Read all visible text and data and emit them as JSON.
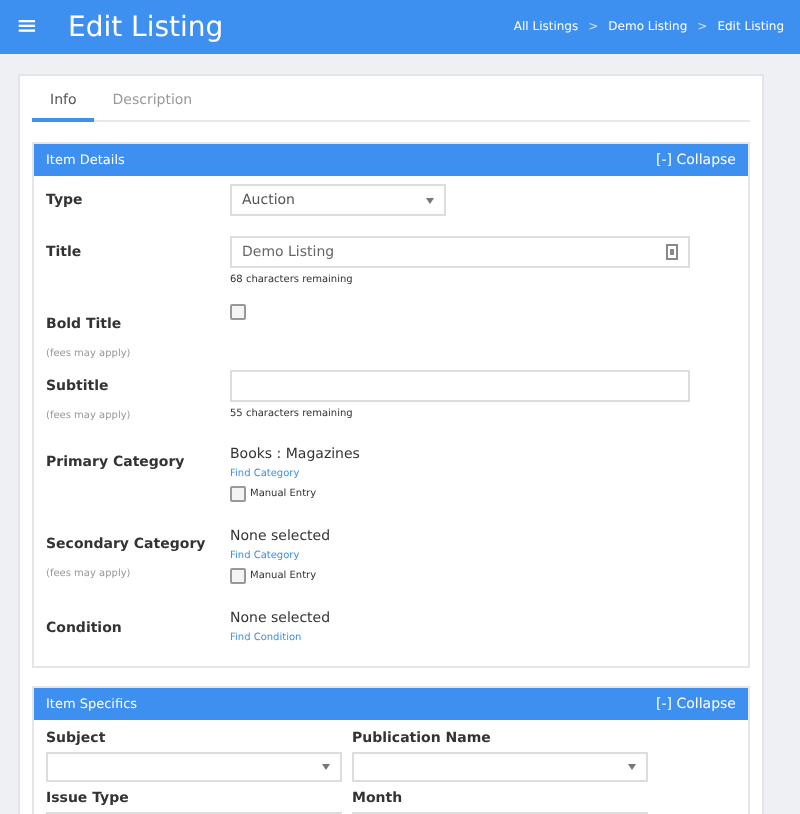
{
  "header": {
    "menu_icon": "≡",
    "title": "Edit Listing",
    "breadcrumbs": [
      "All Listings",
      "Demo Listing",
      "Edit Listing"
    ],
    "separator": ">"
  },
  "tabs": [
    {
      "label": "Info",
      "selected": true
    },
    {
      "label": "Description",
      "selected": false
    }
  ],
  "item_details": {
    "title": "Item Details",
    "collapse": "[-] Collapse",
    "fields": [
      {
        "kind": "select",
        "label": "Type",
        "value": "Auction"
      },
      {
        "kind": "text",
        "label": "Title",
        "value": "Demo Listing",
        "counter": "68 characters remaining"
      },
      {
        "kind": "checkbox",
        "label": "Bold Title",
        "note": "(fees may apply)",
        "checked": false
      },
      {
        "kind": "text",
        "label": "Subtitle",
        "note": "(fees may apply)",
        "counter": "55 characters remaining"
      },
      {
        "kind": "category",
        "label": "Primary Category",
        "value": "Books : Magazines",
        "link": "Find Category",
        "manual": "Manual Entry",
        "checked": false
      },
      {
        "kind": "category",
        "label": "Secondary Category",
        "note": "(fees may apply)",
        "value": "None selected",
        "link": "Find Category",
        "manual": "Manual Entry",
        "checked": false
      },
      {
        "kind": "condition",
        "label": "Condition",
        "value": "None selected",
        "link": "Find Condition"
      }
    ]
  },
  "item_specifics": {
    "title": "Item Specifics",
    "collapse": "[-] Collapse",
    "fields": [
      {
        "label": "Subject"
      },
      {
        "label": "Publication Name"
      },
      {
        "label": "Issue Type"
      },
      {
        "label": "Month"
      }
    ]
  }
}
